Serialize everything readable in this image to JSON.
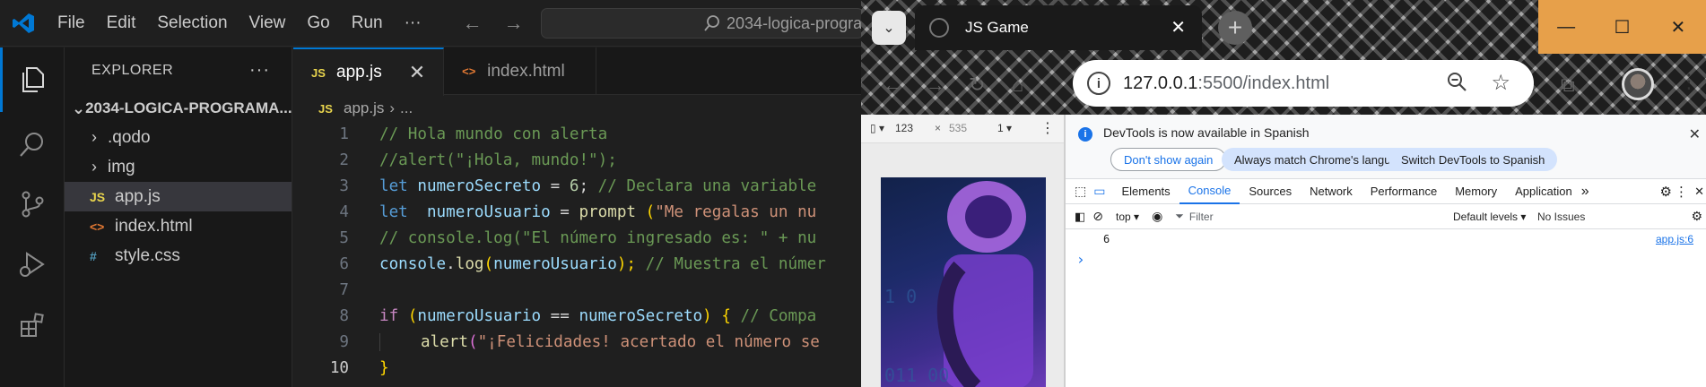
{
  "vscode": {
    "menu": [
      "File",
      "Edit",
      "Selection",
      "View",
      "Go",
      "Run",
      "···"
    ],
    "search_text": "2034-logica-progra",
    "explorer_title": "EXPLORER",
    "explorer_more": "···",
    "folder_name": "2034-LOGICA-PROGRAMA...",
    "tree": [
      {
        "label": ".qodo",
        "kind": "folder"
      },
      {
        "label": "img",
        "kind": "folder"
      },
      {
        "label": "app.js",
        "kind": "js",
        "badge": "JS"
      },
      {
        "label": "index.html",
        "kind": "html",
        "badge": "<>"
      },
      {
        "label": "style.css",
        "kind": "css",
        "badge": "#"
      }
    ],
    "tabs": [
      {
        "label": "app.js",
        "badge": "JS",
        "close": "✕"
      },
      {
        "label": "index.html",
        "badge": "<>"
      }
    ],
    "breadcrumb": {
      "file": "app.js",
      "rest": "...",
      "badge": "JS"
    },
    "code": {
      "line_numbers": [
        "1",
        "2",
        "3",
        "4",
        "5",
        "6",
        "7",
        "8",
        "9",
        "10"
      ],
      "l1_comment": "// Hola mundo con alerta",
      "l2_comment": "//alert(\"¡Hola, mundo!\");",
      "l3_let": "let",
      "l3_var": "numeroSecreto",
      "l3_eq": " = ",
      "l3_num": "6",
      "l3_semi": "; ",
      "l3_comment": "// Declara una variable",
      "l4_let": "let",
      "l4_var": "numeroUsuario",
      "l4_eq": " = ",
      "l4_fn": "prompt",
      "l4_paren": " (",
      "l4_str": "\"Me regalas un nu",
      "l5_comment": "// console.log(\"El número ingresado es: \" + nu",
      "l6_obj": "console",
      "l6_dot": ".",
      "l6_fn": "log",
      "l6_open": "(",
      "l6_var": "numeroUsuario",
      "l6_close": ");",
      "l6_space": " ",
      "l6_comment": "// Muestra el númer",
      "l8_if": "if",
      "l8_open": " (",
      "l8_var1": "numeroUsuario",
      "l8_op": " == ",
      "l8_var2": "numeroSecreto",
      "l8_close": ") ",
      "l8_brace": "{",
      "l8_space": " ",
      "l8_comment": "// Compa",
      "l9_fn": "alert",
      "l9_open": "(",
      "l9_str": "\"¡Felicidades! acertado el número se",
      "l10_brace": "}"
    },
    "colors": {
      "accent": "#0078d4",
      "background": "#1f1f1f",
      "sidebar": "#181818"
    }
  },
  "browser": {
    "tab_title": "JS Game",
    "tab_close": "✕",
    "new_tab": "+",
    "url_host": "127.0.0.1",
    "url_path": ":5500/index.html",
    "window_controls": {
      "minimize": "—",
      "maximize": "☐",
      "close": "✕"
    },
    "device": {
      "width": "123",
      "height": "535",
      "x": "×",
      "zoom": "1"
    },
    "devtools": {
      "infobar_message": "DevTools is now available in Spanish",
      "btn_dont_show": "Don't show again",
      "btn_match_language": "Always match Chrome's language",
      "btn_switch_spanish": "Switch DevTools to Spanish",
      "tabs": [
        "Elements",
        "Console",
        "Sources",
        "Network",
        "Performance",
        "Memory",
        "Application"
      ],
      "more_tabs": "»",
      "context": "top",
      "filter_placeholder": "Filter",
      "levels": "Default levels",
      "issues": "No Issues",
      "log_value": "6",
      "log_source": "app.js:6",
      "prompt_glyph": "›"
    },
    "colors": {
      "window_controls": "#e7a04a",
      "devtools_accent": "#1a73e8"
    }
  }
}
